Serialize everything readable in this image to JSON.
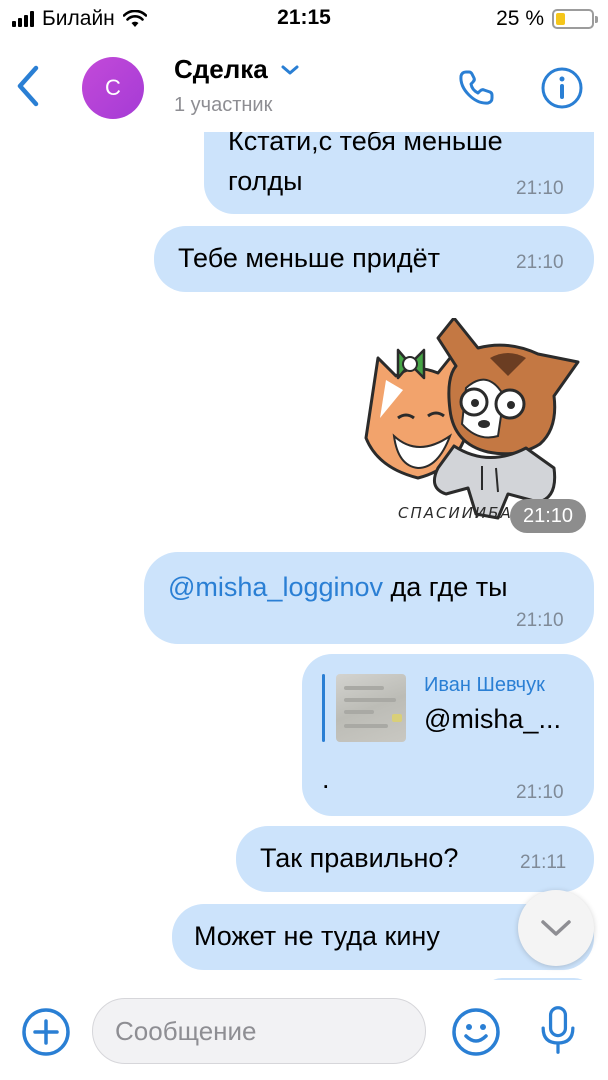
{
  "status_bar": {
    "carrier": "Билайн",
    "time": "21:15",
    "battery": "25 %",
    "battery_level": 0.25
  },
  "header": {
    "avatar_letter": "С",
    "title": "Сделка",
    "subtitle": "1 участник",
    "accent": "#2a7fd4"
  },
  "messages": [
    {
      "text_line1": "Кстати,с тебя меньше",
      "text_line2": "голды",
      "time": "21:10"
    },
    {
      "text": "Тебе меньше придёт",
      "time": "21:10"
    },
    {
      "sticker_text": "СПАСИИИБА!",
      "time": "21:10"
    },
    {
      "mention": "@misha_logginov",
      "text": " да где ты",
      "time": "21:10"
    },
    {
      "reply_author": "Иван Шевчук",
      "reply_text": "@misha_...",
      "text": ".",
      "time": "21:10"
    },
    {
      "text": "Так правильно?",
      "time": "21:11"
    },
    {
      "text": "Может не туда кину"
    }
  ],
  "composer": {
    "placeholder": "Сообщение"
  },
  "icons": [
    "back-icon",
    "chevron-down-icon",
    "phone-icon",
    "info-icon",
    "plus-icon",
    "emoji-icon",
    "microphone-icon",
    "scroll-down-icon"
  ],
  "colors": {
    "bubble": "#cce3fb",
    "accent": "#2a7fd4",
    "avatar": "#b844d8"
  }
}
